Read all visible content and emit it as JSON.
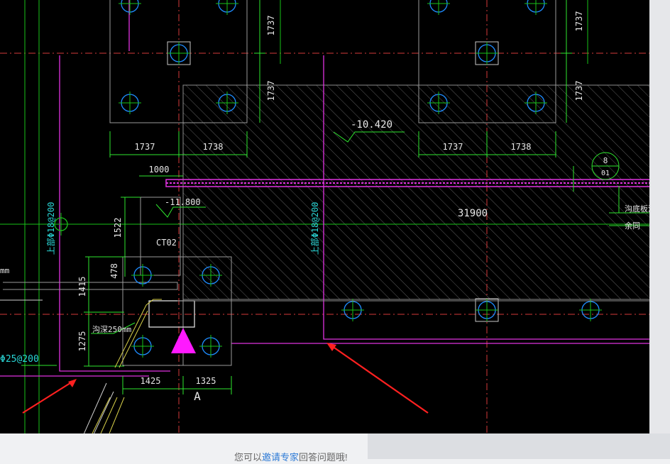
{
  "drawing": {
    "colors": {
      "background": "#000000",
      "grid_green": "#19c219",
      "dimension_green": "#2ee62e",
      "pile_blue": "#1e8cff",
      "cap_grey": "#c9c9c9",
      "beam_magenta": "#e032e0",
      "hatch_grey": "#7a7a7a",
      "text_white": "#e6e6e6",
      "rebar_cyan": "#29d6d6",
      "axis_red": "#d43a3a",
      "annotation_red": "#ff2020",
      "marker_magenta": "#ff19ff"
    },
    "dimensions": {
      "top_left_vert_1": "1737",
      "top_left_vert_2": "1737",
      "top_right_vert_1": "1737",
      "top_right_vert_2": "1737",
      "left_group_h1": "1737",
      "left_group_h2": "1738",
      "right_group_h1": "1737",
      "right_group_h2": "1738",
      "small_1000": "1000",
      "v1522": "1522",
      "v478": "478",
      "v1415": "1415",
      "v1275": "1275",
      "bottom_1425": "1425",
      "bottom_1325": "1325",
      "span_31900": "31900"
    },
    "labels": {
      "elevation_main": "-10.420",
      "elevation_small": "-11.800",
      "cap_code": "CT02",
      "rebar_left": "上部Φ18@200",
      "rebar_mid": "上部Φ18@200",
      "rebar_bottom": "Φ25@200",
      "depth_note": "沟深250mm",
      "left_edge_text": "mm",
      "axis_letter": "A",
      "section_top": "8",
      "section_bottom": "01",
      "note_1": "沟底板深",
      "note_2": "余同"
    }
  },
  "footer": {
    "prefix": "您可以",
    "link": "邀请专家",
    "suffix": "回答问题哦!"
  }
}
